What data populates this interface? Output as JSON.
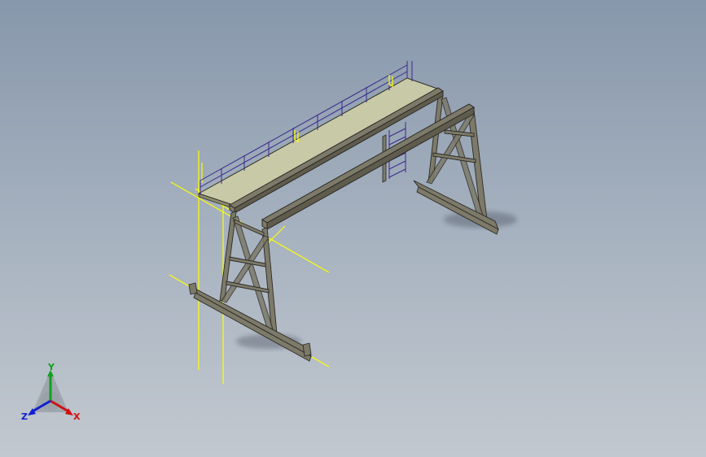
{
  "viewport": {
    "background_top": "#8797ab",
    "background_bottom": "#c2c8cf"
  },
  "model": {
    "steel_color": "#7d7a6a",
    "steel_edge_color": "#2b2a24",
    "deck_color": "#c8c9a7",
    "sketch_line_color": "#ffff00",
    "railing_color": "#3a2a8a"
  },
  "triad": {
    "x_label": "X",
    "y_label": "Y",
    "z_label": "Z",
    "x_color": "#d01010",
    "y_color": "#10a020",
    "z_color": "#1020d0"
  }
}
